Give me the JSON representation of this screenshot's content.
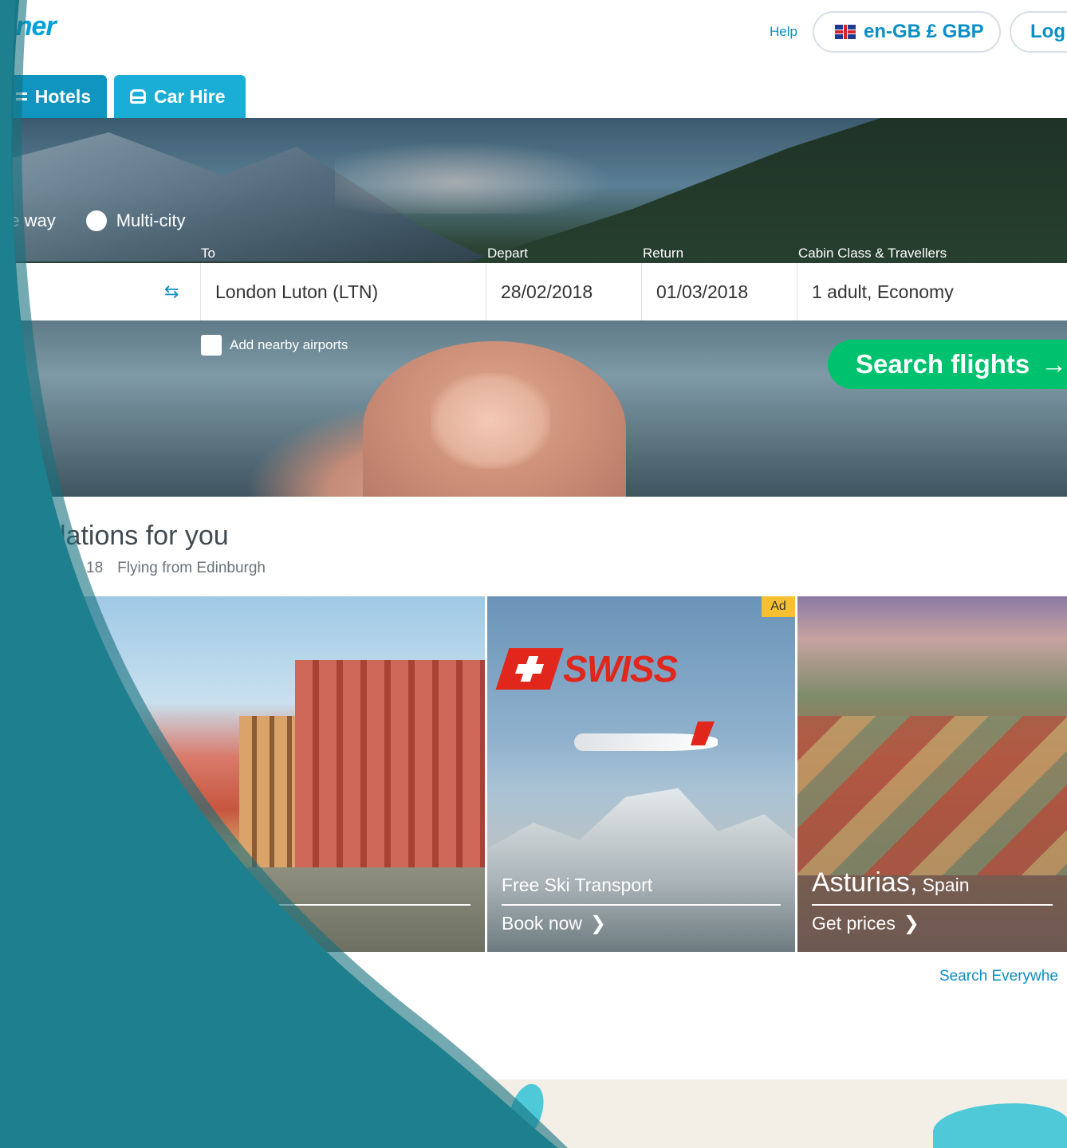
{
  "header": {
    "logo_text": "nner",
    "help_label": "Help",
    "locale_label": "en-GB £ GBP",
    "login_label": "Log"
  },
  "tabs": [
    {
      "label": "Hotels",
      "icon": "bed-icon"
    },
    {
      "label": "Car Hire",
      "icon": "car-icon"
    }
  ],
  "search": {
    "trip_options": [
      "ne way",
      "Multi-city"
    ],
    "labels": {
      "to": "To",
      "depart": "Depart",
      "return": "Return",
      "cabin": "Cabin Class & Travellers"
    },
    "to_value": "London Luton (LTN)",
    "depart_value": "28/02/2018",
    "return_value": "01/03/2018",
    "cabin_value": "1 adult, Economy",
    "nearby_label": "Add nearby airports",
    "button_label": "Search flights",
    "button_color": "#00c16d"
  },
  "inspiration": {
    "title": "lations for you",
    "sub_prefix": "18",
    "sub_text": "Flying from Edinburgh",
    "cards": [
      {
        "title": "",
        "cta": ""
      },
      {
        "ad_label": "Ad",
        "brand": "SWISS",
        "title": "Free Ski Transport",
        "cta": "Book now"
      },
      {
        "city": "Asturias,",
        "country": "Spain",
        "cta": "Get prices"
      }
    ],
    "search_everywhere": "Search Everywhe"
  },
  "colors": {
    "accent": "#0a8fc4",
    "tab": "#00a3cf",
    "overlay_teal": "#1e7f8e"
  }
}
